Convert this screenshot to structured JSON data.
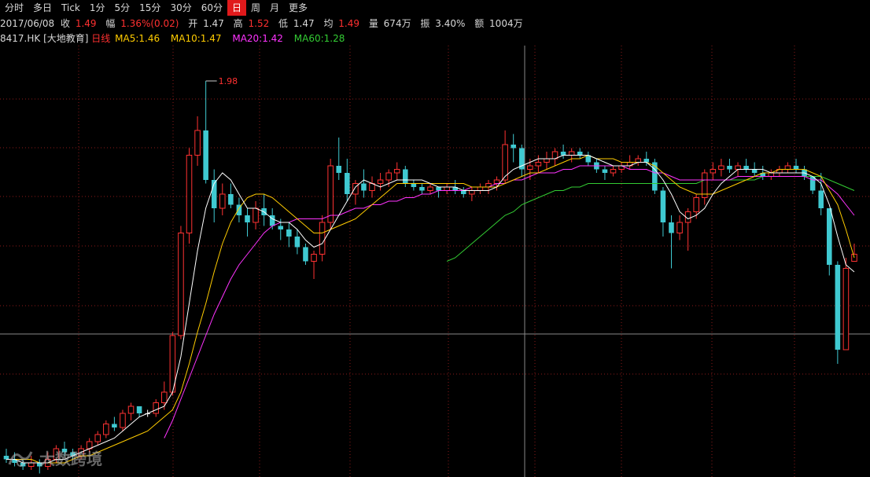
{
  "tabs": [
    {
      "label": "分时",
      "active": false
    },
    {
      "label": "多日",
      "active": false
    },
    {
      "label": "Tick",
      "active": false
    },
    {
      "label": "1分",
      "active": false
    },
    {
      "label": "5分",
      "active": false
    },
    {
      "label": "15分",
      "active": false
    },
    {
      "label": "30分",
      "active": false
    },
    {
      "label": "60分",
      "active": false
    },
    {
      "label": "日",
      "active": true
    },
    {
      "label": "周",
      "active": false
    },
    {
      "label": "月",
      "active": false
    },
    {
      "label": "更多",
      "active": false
    }
  ],
  "info": {
    "date": "2017/06/08",
    "close_label": "收",
    "close": "1.49",
    "change_label": "幅",
    "change": "1.36%(0.02)",
    "open_label": "开",
    "open": "1.47",
    "high_label": "高",
    "high": "1.52",
    "low_label": "低",
    "low": "1.47",
    "avg_label": "均",
    "avg": "1.49",
    "volume_label": "量",
    "volume": "674万",
    "amplitude_label": "振",
    "amplitude": "3.40%",
    "amount_label": "额",
    "amount": "1004万"
  },
  "legend": {
    "code": "8417.HK",
    "name": "[大地教育]",
    "period": "日线",
    "ma5": "MA5:1.46",
    "ma10": "MA10:1.47",
    "ma20": "MA20:1.42",
    "ma60": "MA60:1.28"
  },
  "colors": {
    "up": "#ff3232",
    "down": "#3fc9d1",
    "flat": "#ffffff",
    "grid": "#8b1a1a",
    "ma5": "#ffffff",
    "ma10": "#ffcc00",
    "ma20": "#ff33ff",
    "ma60": "#33cc33"
  },
  "watermark": "大数跨境",
  "chart_data": {
    "type": "candlestick",
    "title": "8417.HK [大地教育] 日线",
    "high_marker": "1.98",
    "y_range": [
      0.86,
      2.08
    ],
    "ohlc": [
      [
        0.92,
        0.94,
        0.9,
        0.91
      ],
      [
        0.91,
        0.93,
        0.89,
        0.9
      ],
      [
        0.9,
        0.91,
        0.88,
        0.89
      ],
      [
        0.89,
        0.92,
        0.88,
        0.9
      ],
      [
        0.9,
        0.91,
        0.87,
        0.89
      ],
      [
        0.89,
        0.93,
        0.88,
        0.91
      ],
      [
        0.91,
        0.95,
        0.9,
        0.94
      ],
      [
        0.94,
        0.96,
        0.92,
        0.93
      ],
      [
        0.93,
        0.94,
        0.91,
        0.92
      ],
      [
        0.92,
        0.95,
        0.91,
        0.94
      ],
      [
        0.94,
        0.97,
        0.93,
        0.96
      ],
      [
        0.96,
        0.99,
        0.95,
        0.98
      ],
      [
        0.98,
        1.02,
        0.97,
        1.01
      ],
      [
        1.01,
        1.03,
        0.99,
        1.0
      ],
      [
        1.0,
        1.05,
        0.99,
        1.04
      ],
      [
        1.04,
        1.07,
        1.02,
        1.06
      ],
      [
        1.06,
        1.06,
        1.03,
        1.04
      ],
      [
        1.04,
        1.05,
        1.03,
        1.04
      ],
      [
        1.04,
        1.08,
        1.03,
        1.07
      ],
      [
        1.07,
        1.13,
        1.05,
        1.1
      ],
      [
        1.1,
        1.27,
        1.09,
        1.26
      ],
      [
        1.26,
        1.57,
        1.25,
        1.55
      ],
      [
        1.55,
        1.79,
        1.52,
        1.77
      ],
      [
        1.77,
        1.88,
        1.74,
        1.84
      ],
      [
        1.84,
        1.98,
        1.69,
        1.7
      ],
      [
        1.7,
        1.73,
        1.58,
        1.62
      ],
      [
        1.62,
        1.69,
        1.6,
        1.66
      ],
      [
        1.66,
        1.69,
        1.62,
        1.63
      ],
      [
        1.63,
        1.65,
        1.58,
        1.6
      ],
      [
        1.6,
        1.62,
        1.54,
        1.58
      ],
      [
        1.58,
        1.64,
        1.56,
        1.62
      ],
      [
        1.62,
        1.66,
        1.57,
        1.6
      ],
      [
        1.6,
        1.62,
        1.56,
        1.57
      ],
      [
        1.57,
        1.59,
        1.53,
        1.56
      ],
      [
        1.56,
        1.58,
        1.51,
        1.54
      ],
      [
        1.54,
        1.56,
        1.49,
        1.51
      ],
      [
        1.51,
        1.52,
        1.46,
        1.47
      ],
      [
        1.47,
        1.5,
        1.42,
        1.49
      ],
      [
        1.49,
        1.6,
        1.47,
        1.58
      ],
      [
        1.58,
        1.76,
        1.56,
        1.74
      ],
      [
        1.74,
        1.82,
        1.7,
        1.72
      ],
      [
        1.72,
        1.76,
        1.64,
        1.66
      ],
      [
        1.66,
        1.7,
        1.63,
        1.69
      ],
      [
        1.69,
        1.73,
        1.65,
        1.67
      ],
      [
        1.67,
        1.71,
        1.65,
        1.69
      ],
      [
        1.69,
        1.72,
        1.67,
        1.7
      ],
      [
        1.7,
        1.73,
        1.68,
        1.72
      ],
      [
        1.72,
        1.75,
        1.7,
        1.73
      ],
      [
        1.73,
        1.74,
        1.68,
        1.69
      ],
      [
        1.69,
        1.7,
        1.67,
        1.68
      ],
      [
        1.68,
        1.69,
        1.66,
        1.67
      ],
      [
        1.67,
        1.69,
        1.66,
        1.68
      ],
      [
        1.68,
        1.68,
        1.65,
        1.67
      ],
      [
        1.67,
        1.69,
        1.66,
        1.68
      ],
      [
        1.68,
        1.7,
        1.66,
        1.67
      ],
      [
        1.67,
        1.68,
        1.65,
        1.66
      ],
      [
        1.66,
        1.68,
        1.64,
        1.67
      ],
      [
        1.67,
        1.69,
        1.66,
        1.68
      ],
      [
        1.68,
        1.7,
        1.66,
        1.69
      ],
      [
        1.69,
        1.71,
        1.67,
        1.7
      ],
      [
        1.7,
        1.84,
        1.69,
        1.8
      ],
      [
        1.8,
        1.83,
        1.75,
        1.79
      ],
      [
        1.79,
        1.8,
        1.71,
        1.73
      ],
      [
        1.73,
        1.76,
        1.7,
        1.74
      ],
      [
        1.74,
        1.77,
        1.72,
        1.75
      ],
      [
        1.75,
        1.78,
        1.73,
        1.76
      ],
      [
        1.76,
        1.79,
        1.74,
        1.78
      ],
      [
        1.78,
        1.8,
        1.76,
        1.77
      ],
      [
        1.77,
        1.79,
        1.75,
        1.78
      ],
      [
        1.78,
        1.79,
        1.76,
        1.77
      ],
      [
        1.77,
        1.78,
        1.74,
        1.75
      ],
      [
        1.75,
        1.76,
        1.72,
        1.73
      ],
      [
        1.73,
        1.74,
        1.7,
        1.72
      ],
      [
        1.72,
        1.74,
        1.71,
        1.73
      ],
      [
        1.73,
        1.75,
        1.72,
        1.74
      ],
      [
        1.74,
        1.77,
        1.73,
        1.75
      ],
      [
        1.75,
        1.77,
        1.74,
        1.76
      ],
      [
        1.76,
        1.78,
        1.74,
        1.75
      ],
      [
        1.75,
        1.76,
        1.66,
        1.67
      ],
      [
        1.67,
        1.68,
        1.54,
        1.58
      ],
      [
        1.58,
        1.6,
        1.45,
        1.55
      ],
      [
        1.55,
        1.6,
        1.53,
        1.58
      ],
      [
        1.58,
        1.62,
        1.5,
        1.61
      ],
      [
        1.61,
        1.66,
        1.59,
        1.65
      ],
      [
        1.65,
        1.73,
        1.63,
        1.72
      ],
      [
        1.72,
        1.75,
        1.7,
        1.73
      ],
      [
        1.73,
        1.76,
        1.71,
        1.74
      ],
      [
        1.74,
        1.76,
        1.72,
        1.73
      ],
      [
        1.73,
        1.75,
        1.71,
        1.74
      ],
      [
        1.74,
        1.76,
        1.72,
        1.73
      ],
      [
        1.73,
        1.75,
        1.71,
        1.72
      ],
      [
        1.72,
        1.74,
        1.7,
        1.71
      ],
      [
        1.71,
        1.73,
        1.7,
        1.72
      ],
      [
        1.72,
        1.74,
        1.71,
        1.73
      ],
      [
        1.73,
        1.75,
        1.72,
        1.74
      ],
      [
        1.74,
        1.76,
        1.72,
        1.73
      ],
      [
        1.73,
        1.74,
        1.7,
        1.71
      ],
      [
        1.71,
        1.67,
        1.66,
        1.67
      ],
      [
        1.67,
        1.72,
        1.6,
        1.62
      ],
      [
        1.62,
        1.6,
        1.43,
        1.46
      ],
      [
        1.46,
        1.47,
        1.18,
        1.22
      ],
      [
        1.22,
        1.48,
        1.22,
        1.45
      ],
      [
        1.47,
        1.52,
        1.47,
        1.49
      ]
    ],
    "ma5": [
      0.91,
      0.91,
      0.9,
      0.9,
      0.9,
      0.9,
      0.91,
      0.91,
      0.92,
      0.93,
      0.94,
      0.95,
      0.96,
      0.97,
      0.99,
      1.01,
      1.03,
      1.04,
      1.05,
      1.06,
      1.1,
      1.2,
      1.35,
      1.5,
      1.62,
      1.69,
      1.72,
      1.7,
      1.66,
      1.62,
      1.62,
      1.61,
      1.59,
      1.58,
      1.58,
      1.56,
      1.53,
      1.51,
      1.52,
      1.56,
      1.6,
      1.64,
      1.68,
      1.7,
      1.69,
      1.68,
      1.69,
      1.7,
      1.7,
      1.7,
      1.7,
      1.69,
      1.68,
      1.68,
      1.68,
      1.67,
      1.67,
      1.67,
      1.67,
      1.68,
      1.71,
      1.73,
      1.74,
      1.75,
      1.76,
      1.76,
      1.76,
      1.77,
      1.77,
      1.77,
      1.77,
      1.76,
      1.75,
      1.74,
      1.74,
      1.74,
      1.75,
      1.75,
      1.73,
      1.7,
      1.66,
      1.61,
      1.59,
      1.6,
      1.62,
      1.66,
      1.69,
      1.71,
      1.73,
      1.73,
      1.73,
      1.73,
      1.72,
      1.72,
      1.72,
      1.72,
      1.72,
      1.71,
      1.69,
      1.63,
      1.54,
      1.46,
      1.44
    ],
    "ma10": [
      0.91,
      0.91,
      0.91,
      0.91,
      0.9,
      0.9,
      0.9,
      0.9,
      0.91,
      0.92,
      0.92,
      0.93,
      0.94,
      0.95,
      0.96,
      0.97,
      0.98,
      0.99,
      1.01,
      1.03,
      1.05,
      1.1,
      1.18,
      1.27,
      1.35,
      1.44,
      1.52,
      1.58,
      1.62,
      1.65,
      1.66,
      1.66,
      1.65,
      1.63,
      1.61,
      1.59,
      1.57,
      1.55,
      1.55,
      1.56,
      1.57,
      1.58,
      1.59,
      1.61,
      1.63,
      1.65,
      1.67,
      1.69,
      1.69,
      1.69,
      1.69,
      1.69,
      1.69,
      1.69,
      1.69,
      1.69,
      1.68,
      1.68,
      1.68,
      1.68,
      1.69,
      1.7,
      1.71,
      1.72,
      1.72,
      1.73,
      1.74,
      1.75,
      1.76,
      1.76,
      1.77,
      1.76,
      1.76,
      1.76,
      1.75,
      1.75,
      1.75,
      1.75,
      1.74,
      1.72,
      1.7,
      1.68,
      1.67,
      1.66,
      1.66,
      1.66,
      1.67,
      1.68,
      1.69,
      1.7,
      1.71,
      1.72,
      1.72,
      1.73,
      1.73,
      1.73,
      1.73,
      1.72,
      1.71,
      1.67,
      1.63,
      1.56,
      1.48
    ],
    "ma20": [
      null,
      null,
      null,
      null,
      null,
      null,
      null,
      null,
      null,
      null,
      null,
      null,
      null,
      null,
      null,
      null,
      null,
      null,
      null,
      0.97,
      1.02,
      1.08,
      1.14,
      1.2,
      1.26,
      1.32,
      1.37,
      1.42,
      1.46,
      1.49,
      1.52,
      1.55,
      1.57,
      1.58,
      1.58,
      1.59,
      1.59,
      1.59,
      1.59,
      1.6,
      1.6,
      1.61,
      1.62,
      1.62,
      1.63,
      1.63,
      1.64,
      1.64,
      1.65,
      1.65,
      1.66,
      1.66,
      1.67,
      1.67,
      1.67,
      1.67,
      1.68,
      1.68,
      1.68,
      1.69,
      1.69,
      1.7,
      1.7,
      1.71,
      1.72,
      1.72,
      1.72,
      1.73,
      1.73,
      1.74,
      1.74,
      1.74,
      1.74,
      1.74,
      1.74,
      1.73,
      1.73,
      1.73,
      1.72,
      1.72,
      1.71,
      1.7,
      1.7,
      1.7,
      1.7,
      1.7,
      1.7,
      1.7,
      1.71,
      1.71,
      1.71,
      1.71,
      1.71,
      1.71,
      1.71,
      1.71,
      1.71,
      1.7,
      1.7,
      1.68,
      1.66,
      1.63,
      1.6
    ],
    "ma60": [
      null,
      null,
      null,
      null,
      null,
      null,
      null,
      null,
      null,
      null,
      null,
      null,
      null,
      null,
      null,
      null,
      null,
      null,
      null,
      null,
      null,
      null,
      null,
      null,
      null,
      null,
      null,
      null,
      null,
      null,
      null,
      null,
      null,
      null,
      null,
      null,
      null,
      null,
      null,
      null,
      null,
      null,
      null,
      null,
      null,
      null,
      null,
      null,
      null,
      null,
      null,
      null,
      null,
      1.47,
      1.48,
      1.5,
      1.52,
      1.54,
      1.56,
      1.58,
      1.6,
      1.61,
      1.63,
      1.64,
      1.65,
      1.66,
      1.67,
      1.67,
      1.68,
      1.68,
      1.69,
      1.69,
      1.69,
      1.69,
      1.69,
      1.69,
      1.69,
      1.69,
      1.69,
      1.69,
      1.69,
      1.69,
      1.69,
      1.69,
      1.7,
      1.7,
      1.7,
      1.7,
      1.7,
      1.7,
      1.7,
      1.71,
      1.71,
      1.71,
      1.71,
      1.71,
      1.71,
      1.71,
      1.71,
      1.7,
      1.69,
      1.68,
      1.67
    ]
  }
}
